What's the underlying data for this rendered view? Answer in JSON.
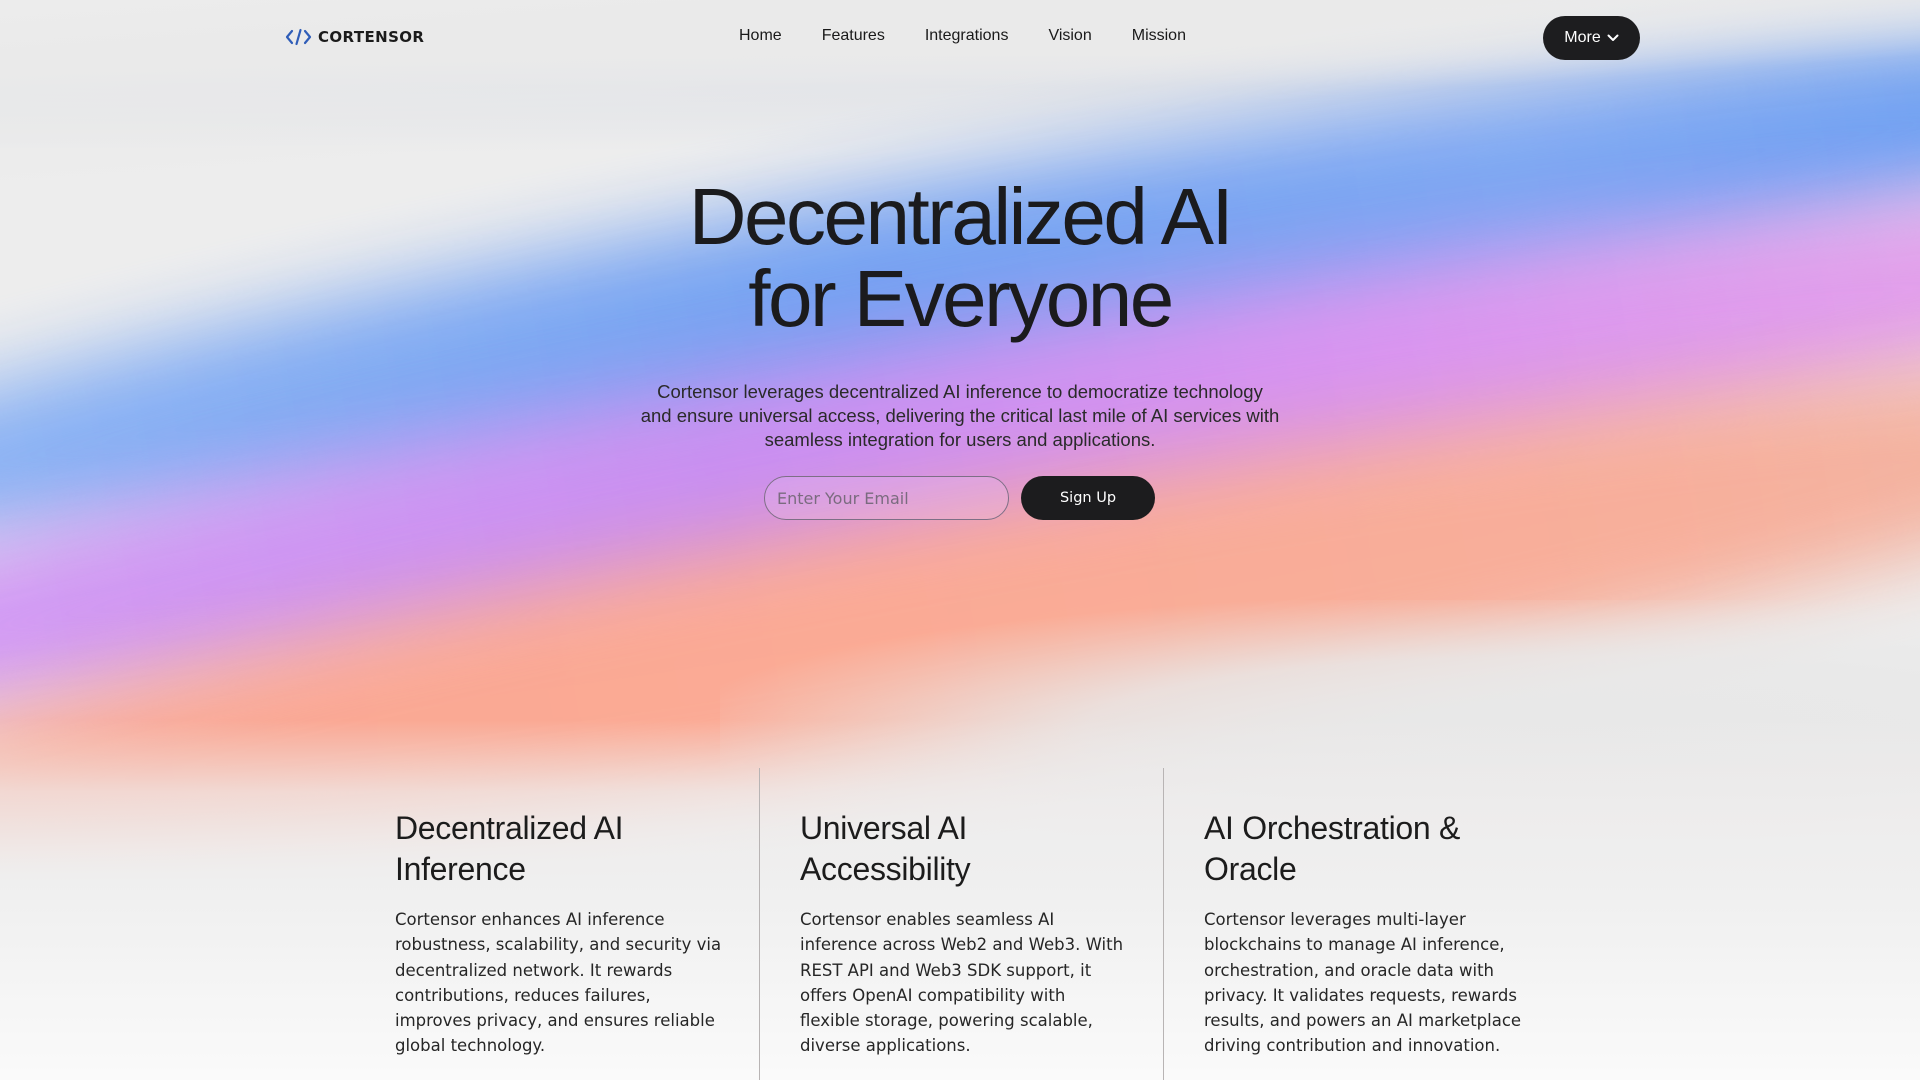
{
  "nav": {
    "logo_text": "CORTENSOR",
    "logo_icon": "code-brackets-icon",
    "links": [
      "Home",
      "Features",
      "Integrations",
      "Vision",
      "Mission"
    ],
    "more_label": "More",
    "more_icon": "chevron-down-icon"
  },
  "hero": {
    "title_line1": "Decentralized AI",
    "title_line2": "for Everyone",
    "subtitle": "Cortensor leverages decentralized AI inference to democratize technology and ensure universal access, delivering the critical last mile of AI services with seamless integration for users and applications.",
    "email_placeholder": "Enter Your Email",
    "email_value": "",
    "signup_label": "Sign Up"
  },
  "features": [
    {
      "title": "Decentralized AI Inference",
      "description": "Cortensor enhances AI inference robustness, scalability, and security via decentralized network. It rewards contributions, reduces failures, improves privacy, and ensures reliable global technology."
    },
    {
      "title": "Universal AI Accessibility",
      "description": "Cortensor enables seamless AI inference across Web2 and Web3. With REST API and Web3 SDK support, it offers OpenAI compatibility with flexible storage, powering scalable, diverse applications."
    },
    {
      "title": "AI Orchestration & Oracle",
      "description": "Cortensor leverages multi-layer blockchains to manage AI inference, orchestration, and oracle data with privacy. It validates requests, rewards results, and powers an AI marketplace driving contribution and innovation."
    }
  ],
  "colors": {
    "dark_button": "#1d1d1f",
    "logo_blue": "#2f5db8",
    "gradient_blue": "#6f9ef2",
    "gradient_purple": "#c98bf1",
    "gradient_orange": "#fca891"
  }
}
